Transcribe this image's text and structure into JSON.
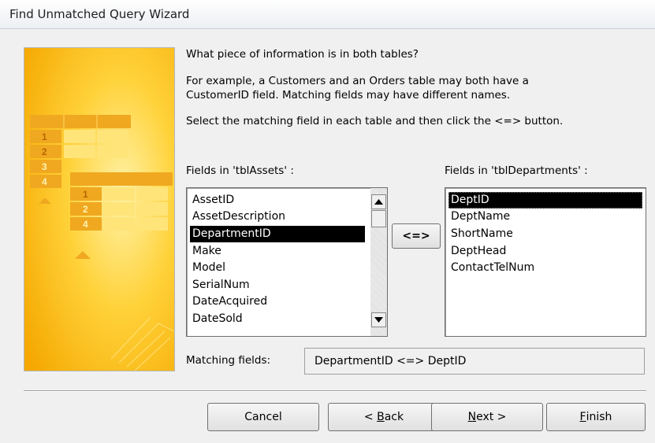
{
  "window": {
    "title": "Find Unmatched Query Wizard"
  },
  "instructions": {
    "question": "What piece of information is in both tables?",
    "example_line1": "For example, a Customers and an Orders table may both have a",
    "example_line2": "CustomerID field. Matching fields may have different names.",
    "select_line": "Select the matching field in each table and then click the <=> button."
  },
  "left_list": {
    "label": "Fields in 'tblAssets' :",
    "items": [
      "AssetID",
      "AssetDescription",
      "DepartmentID",
      "Make",
      "Model",
      "SerialNum",
      "DateAcquired",
      "DateSold"
    ],
    "selected": "DepartmentID"
  },
  "right_list": {
    "label": "Fields in 'tblDepartments' :",
    "items": [
      "DeptID",
      "DeptName",
      "ShortName",
      "DeptHead",
      "ContactTelNum"
    ],
    "selected": "DeptID"
  },
  "match_button": {
    "label": "<=>"
  },
  "matching": {
    "label": "Matching fields:",
    "value": "DepartmentID <=> DeptID"
  },
  "illustration": {
    "table_a_rows": [
      "1",
      "2",
      "3",
      "4"
    ],
    "table_b_rows": [
      "1",
      "2",
      "4"
    ]
  },
  "buttons": {
    "cancel": "Cancel",
    "back_prefix": "< ",
    "back_key": "B",
    "back_rest": "ack",
    "next_key": "N",
    "next_rest": "ext >",
    "finish_key": "F",
    "finish_rest": "inish"
  },
  "colors": {
    "illustration_bg": "#ffc000",
    "selection": "#000000",
    "dialog_bg": "#f0f0f0"
  }
}
